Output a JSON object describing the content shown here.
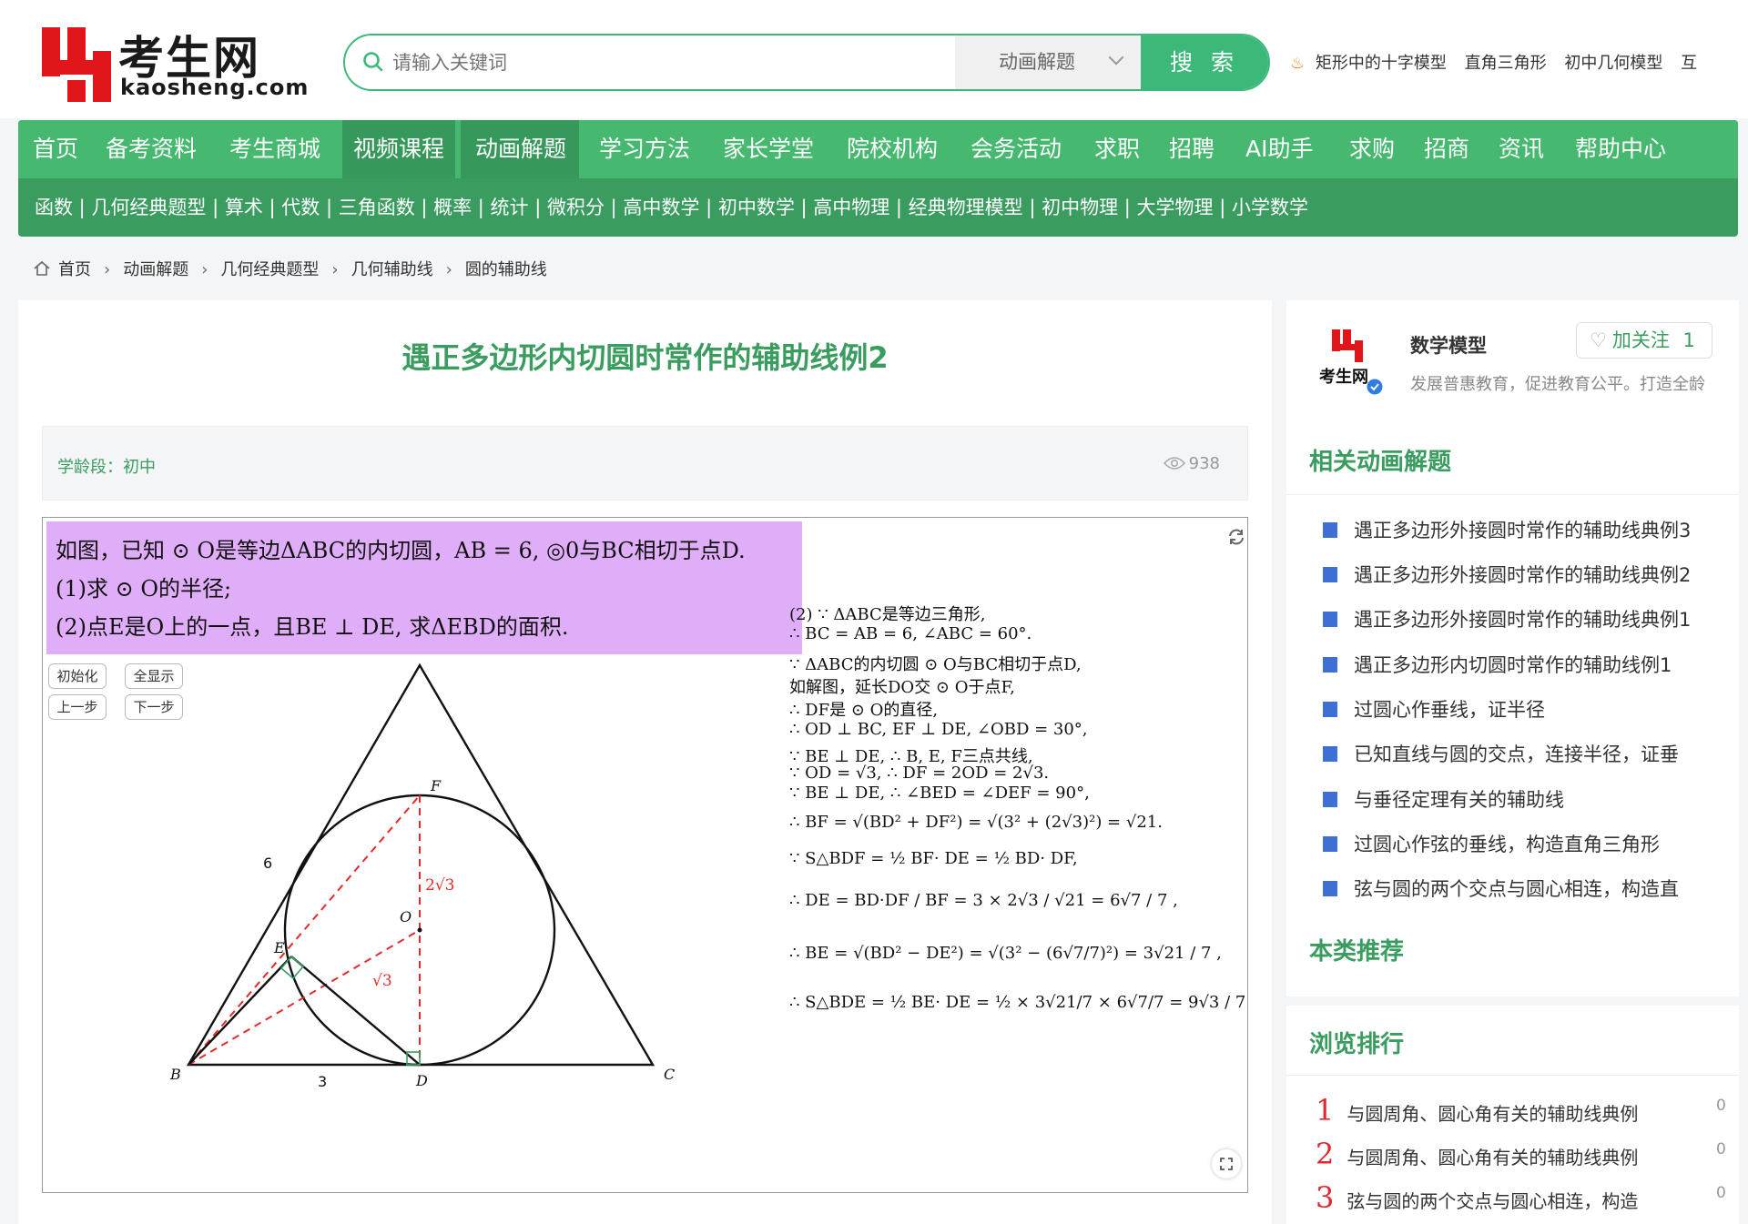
{
  "logo": {
    "cn": "考生网",
    "en": "kaosheng.com"
  },
  "search": {
    "placeholder": "请输入关键词",
    "category": "动画解题",
    "button": "搜 索"
  },
  "hot_keywords": [
    "矩形中的十字模型",
    "直角三角形",
    "初中几何模型",
    "互"
  ],
  "nav_main": [
    "首页",
    "备考资料",
    "考生商城",
    "视频课程",
    "动画解题",
    "学习方法",
    "家长学堂",
    "院校机构",
    "会务活动",
    "求职",
    "招聘",
    "AI助手",
    "求购",
    "招商",
    "资讯",
    "帮助中心"
  ],
  "nav_sub": "函数 | 几何经典题型 | 算术 | 代数 | 三角函数 | 概率 | 统计 | 微积分 | 高中数学 | 初中数学 | 高中物理 | 经典物理模型 | 初中物理 | 大学物理 | 小学数学",
  "breadcrumb": [
    "首页",
    "动画解题",
    "几何经典题型",
    "几何辅助线",
    "圆的辅助线"
  ],
  "article": {
    "title": "遇正多边形内切圆时常作的辅助线例2",
    "level": "学龄段：初中",
    "views": "938"
  },
  "question": [
    "如图，已知 ⊙ O是等边ΔABC的内切圆，AB = 6, ◎0与BC相切于点D.",
    "(1)求 ⊙ O的半径;",
    "(2)点E是O上的一点，且BE ⊥ DE, 求ΔEBD的面积."
  ],
  "controls": {
    "init": "初始化",
    "showall": "全显示",
    "prev": "上一步",
    "next": "下一步"
  },
  "figure": {
    "labels": {
      "A": "",
      "F": "F",
      "O": "O",
      "E": "E",
      "B": "B",
      "D": "D",
      "C": "C"
    },
    "side_left": "6",
    "side_bottom": "3",
    "seg_df": "2√3",
    "seg_od": "√3"
  },
  "solution": [
    "(2) ∵ ΔABC是等边三角形,",
    "∴ BC = AB = 6, ∠ABC = 60°.",
    "∵ ΔABC的内切圆 ⊙ O与BC相切于点D,",
    "如解图，延长DO交 ⊙ O于点F,",
    "∴ DF是 ⊙ O的直径,",
    "∴ OD ⊥ BC, EF ⊥ DE, ∠OBD = 30°,",
    "∵ BE ⊥ DE, ∴ B, E, F三点共线,",
    "∵ OD = √3, ∴ DF = 2OD = 2√3.",
    "∵ BE ⊥ DE, ∴ ∠BED = ∠DEF = 90°,",
    "∴ BF = √(BD² + DF²) = √(3² + (2√3)²) = √21.",
    "∵ S△BDF = ½ BF· DE = ½ BD· DF,",
    "∴ DE = BD·DF / BF = 3 × 2√3 / √21 = 6√7 / 7 ,",
    "∴ BE = √(BD² − DE²) = √(3² − (6√7/7)²) = 3√21 / 7 ,",
    "∴ S△BDE = ½ BE· DE = ½ × 3√21/7 × 6√7/7 = 9√3 / 7 ."
  ],
  "author": {
    "name": "数学模型",
    "follow": "加关注",
    "follow_count": "1",
    "desc": "发展普惠教育，促进教育公平。打造全龄"
  },
  "related_title": "相关动画解题",
  "related": [
    "遇正多边形外接圆时常作的辅助线典例3",
    "遇正多边形外接圆时常作的辅助线典例2",
    "遇正多边形外接圆时常作的辅助线典例1",
    "遇正多边形内切圆时常作的辅助线例1",
    "过圆心作垂线，证半径",
    "已知直线与圆的交点，连接半径，证垂",
    "与垂径定理有关的辅助线",
    "过圆心作弦的垂线，构造直角三角形",
    "弦与圆的两个交点与圆心相连，构造直"
  ],
  "recommend_title": "本类推荐",
  "ranking_title": "浏览排行",
  "ranking": [
    {
      "no": "1",
      "title": "与圆周角、圆心角有关的辅助线典例",
      "count": "0"
    },
    {
      "no": "2",
      "title": "与圆周角、圆心角有关的辅助线典例",
      "count": "0"
    },
    {
      "no": "3",
      "title": "弦与圆的两个交点与圆心相连，构造",
      "count": "0"
    }
  ],
  "colors": {
    "brand_green": "#46b86f",
    "dark_green": "#3a9c5f",
    "logo_red": "#e0161a",
    "question_bg": "#e0aef8",
    "dash_red": "#e62a2a"
  }
}
